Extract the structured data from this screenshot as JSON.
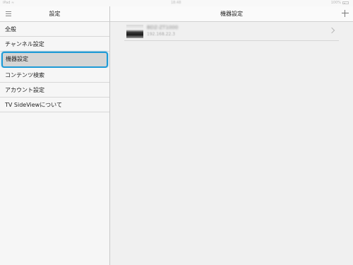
{
  "status_bar": {
    "carrier": "iPad",
    "time": "18:48",
    "battery": "100%"
  },
  "sidebar": {
    "title": "設定",
    "items": [
      {
        "label": "全般"
      },
      {
        "label": "チャンネル設定"
      },
      {
        "label": "機器設定",
        "selected": true
      },
      {
        "label": "コンテンツ検索"
      },
      {
        "label": "アカウント設定"
      },
      {
        "label": "TV SideViewについて"
      }
    ]
  },
  "main": {
    "title": "機器設定",
    "devices": [
      {
        "name": "BDZ-ZT1000",
        "ip": "192.168.22.3"
      }
    ]
  },
  "colors": {
    "selection_border": "#1e9ad6",
    "selection_fill": "#d5d5d5",
    "sidebar_bg": "#f6f6f6",
    "main_bg": "#f0f0f0"
  },
  "icons": {
    "menu": "hamburger-icon",
    "add": "plus-icon",
    "disclosure": "chevron-right-icon",
    "wifi": "wifi-icon",
    "battery": "battery-icon"
  }
}
